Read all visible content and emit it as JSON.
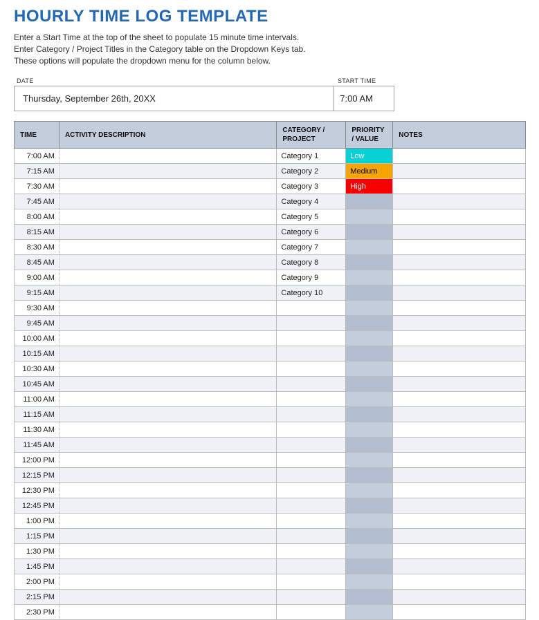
{
  "title": "HOURLY TIME LOG TEMPLATE",
  "instructions": {
    "line1": "Enter a Start Time at the top of the sheet to populate 15 minute time intervals.",
    "line2": "Enter Category / Project Titles in the Category table on the Dropdown Keys tab.",
    "line3": "These options will populate the dropdown menu for the column below."
  },
  "meta": {
    "date_label": "DATE",
    "start_time_label": "START TIME",
    "date_value": "Thursday, September 26th, 20XX",
    "start_time_value": "7:00 AM"
  },
  "headers": {
    "time": "TIME",
    "activity": "ACTIVITY DESCRIPTION",
    "category": "CATEGORY / PROJECT",
    "priority": "PRIORITY / VALUE",
    "notes": "NOTES"
  },
  "rows": [
    {
      "time": "7:00 AM",
      "activity": "",
      "category": "Category 1",
      "priority": "Low",
      "priority_class": "pri-low",
      "notes": ""
    },
    {
      "time": "7:15 AM",
      "activity": "",
      "category": "Category 2",
      "priority": "Medium",
      "priority_class": "pri-medium",
      "notes": ""
    },
    {
      "time": "7:30 AM",
      "activity": "",
      "category": "Category 3",
      "priority": "High",
      "priority_class": "pri-high",
      "notes": ""
    },
    {
      "time": "7:45 AM",
      "activity": "",
      "category": "Category 4",
      "priority": "",
      "priority_class": "",
      "notes": ""
    },
    {
      "time": "8:00 AM",
      "activity": "",
      "category": "Category 5",
      "priority": "",
      "priority_class": "",
      "notes": ""
    },
    {
      "time": "8:15 AM",
      "activity": "",
      "category": "Category 6",
      "priority": "",
      "priority_class": "",
      "notes": ""
    },
    {
      "time": "8:30 AM",
      "activity": "",
      "category": "Category 7",
      "priority": "",
      "priority_class": "",
      "notes": ""
    },
    {
      "time": "8:45 AM",
      "activity": "",
      "category": "Category 8",
      "priority": "",
      "priority_class": "",
      "notes": ""
    },
    {
      "time": "9:00 AM",
      "activity": "",
      "category": "Category 9",
      "priority": "",
      "priority_class": "",
      "notes": ""
    },
    {
      "time": "9:15 AM",
      "activity": "",
      "category": "Category 10",
      "priority": "",
      "priority_class": "",
      "notes": ""
    },
    {
      "time": "9:30 AM",
      "activity": "",
      "category": "",
      "priority": "",
      "priority_class": "",
      "notes": ""
    },
    {
      "time": "9:45 AM",
      "activity": "",
      "category": "",
      "priority": "",
      "priority_class": "",
      "notes": ""
    },
    {
      "time": "10:00 AM",
      "activity": "",
      "category": "",
      "priority": "",
      "priority_class": "",
      "notes": ""
    },
    {
      "time": "10:15 AM",
      "activity": "",
      "category": "",
      "priority": "",
      "priority_class": "",
      "notes": ""
    },
    {
      "time": "10:30 AM",
      "activity": "",
      "category": "",
      "priority": "",
      "priority_class": "",
      "notes": ""
    },
    {
      "time": "10:45 AM",
      "activity": "",
      "category": "",
      "priority": "",
      "priority_class": "",
      "notes": ""
    },
    {
      "time": "11:00 AM",
      "activity": "",
      "category": "",
      "priority": "",
      "priority_class": "",
      "notes": ""
    },
    {
      "time": "11:15 AM",
      "activity": "",
      "category": "",
      "priority": "",
      "priority_class": "",
      "notes": ""
    },
    {
      "time": "11:30 AM",
      "activity": "",
      "category": "",
      "priority": "",
      "priority_class": "",
      "notes": ""
    },
    {
      "time": "11:45 AM",
      "activity": "",
      "category": "",
      "priority": "",
      "priority_class": "",
      "notes": ""
    },
    {
      "time": "12:00 PM",
      "activity": "",
      "category": "",
      "priority": "",
      "priority_class": "",
      "notes": ""
    },
    {
      "time": "12:15 PM",
      "activity": "",
      "category": "",
      "priority": "",
      "priority_class": "",
      "notes": ""
    },
    {
      "time": "12:30 PM",
      "activity": "",
      "category": "",
      "priority": "",
      "priority_class": "",
      "notes": ""
    },
    {
      "time": "12:45 PM",
      "activity": "",
      "category": "",
      "priority": "",
      "priority_class": "",
      "notes": ""
    },
    {
      "time": "1:00 PM",
      "activity": "",
      "category": "",
      "priority": "",
      "priority_class": "",
      "notes": ""
    },
    {
      "time": "1:15 PM",
      "activity": "",
      "category": "",
      "priority": "",
      "priority_class": "",
      "notes": ""
    },
    {
      "time": "1:30 PM",
      "activity": "",
      "category": "",
      "priority": "",
      "priority_class": "",
      "notes": ""
    },
    {
      "time": "1:45 PM",
      "activity": "",
      "category": "",
      "priority": "",
      "priority_class": "",
      "notes": ""
    },
    {
      "time": "2:00 PM",
      "activity": "",
      "category": "",
      "priority": "",
      "priority_class": "",
      "notes": ""
    },
    {
      "time": "2:15 PM",
      "activity": "",
      "category": "",
      "priority": "",
      "priority_class": "",
      "notes": ""
    },
    {
      "time": "2:30 PM",
      "activity": "",
      "category": "",
      "priority": "",
      "priority_class": "",
      "notes": ""
    }
  ]
}
